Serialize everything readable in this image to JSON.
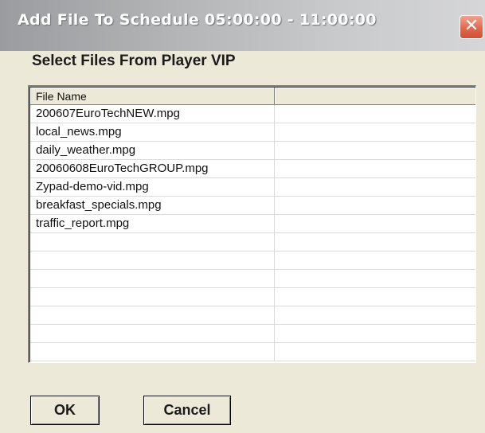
{
  "window": {
    "title": "Add File To Schedule 05:00:00 - 11:00:00",
    "close_glyph": "✕"
  },
  "dialog": {
    "heading": "Select Files From Player VIP"
  },
  "file_list": {
    "columns": [
      "File Name",
      ""
    ],
    "rows": [
      "200607EuroTechNEW.mpg",
      "local_news.mpg",
      "daily_weather.mpg",
      "20060608EuroTechGROUP.mpg",
      "Zypad-demo-vid.mpg",
      "breakfast_specials.mpg",
      "traffic_report.mpg",
      "",
      "",
      "",
      "",
      "",
      "",
      ""
    ]
  },
  "buttons": {
    "ok": "OK",
    "cancel": "Cancel"
  },
  "colors": {
    "close_button": "#e0694e",
    "dialog_background": "#ece9d8"
  }
}
